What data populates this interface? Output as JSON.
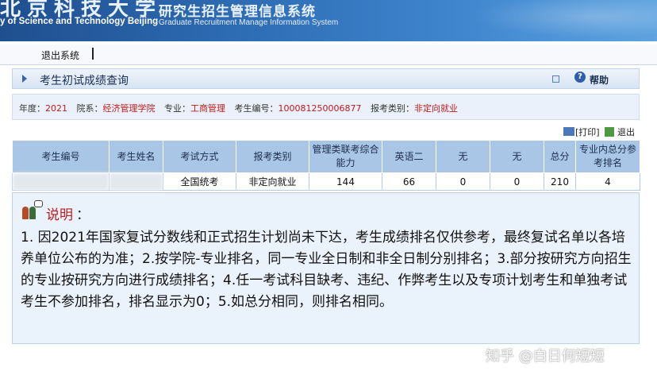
{
  "header": {
    "school_cn": "北京科技大学",
    "school_en": "y of Science and Technology Beijing",
    "system_cn": "研究生招生管理信息系统",
    "system_en": "Graduate Recruitment Manage Information System"
  },
  "toolbar": {
    "logout_label": "退出系统"
  },
  "page": {
    "title": "考生初试成绩查询",
    "help_label": "帮助"
  },
  "info": {
    "year_label": "年度：",
    "year": "2021",
    "dept_label": "院系：",
    "dept": "经济管理学院",
    "major_label": "专业：",
    "major": "工商管理",
    "id_label": "考生编号：",
    "id": "100081250006877",
    "type_label": "报考类别：",
    "type": "非定向就业"
  },
  "actions": {
    "print_label": "[打印]",
    "back_label": "退出"
  },
  "table": {
    "headers": [
      "考生编号",
      "考生姓名",
      "考试方式",
      "报考类别",
      "管理类联考综合能力",
      "英语二",
      "无",
      "无",
      "总分",
      "专业内总分参考排名"
    ],
    "row": [
      "",
      "",
      "全国统考",
      "非定向就业",
      "144",
      "66",
      "0",
      "0",
      "210",
      "4"
    ]
  },
  "notes": {
    "heading": "说明",
    "colon": "：",
    "body": "1. 因2021年国家复试分数线和正式招生计划尚未下达，考生成绩排名仅供参考，最终复试名单以各培养单位公布的为准；2.按学院-专业排名，同一专业全日制和非全日制分别排名；3.部分按研究方向招生的专业按研究方向进行成绩排名；4.任一考试科目缺考、违纪、作弊考生以及专项计划考生和单独考试考生不参加排名，排名显示为0；5.如总分相同，则排名相同。"
  },
  "watermark": "知乎 @白日何短短",
  "colors": {
    "accent_red": "#c21a1a",
    "header_blue": "#2f6fb7",
    "table_header": "#a9c6e6",
    "panel_bg": "#eaf2fb"
  }
}
